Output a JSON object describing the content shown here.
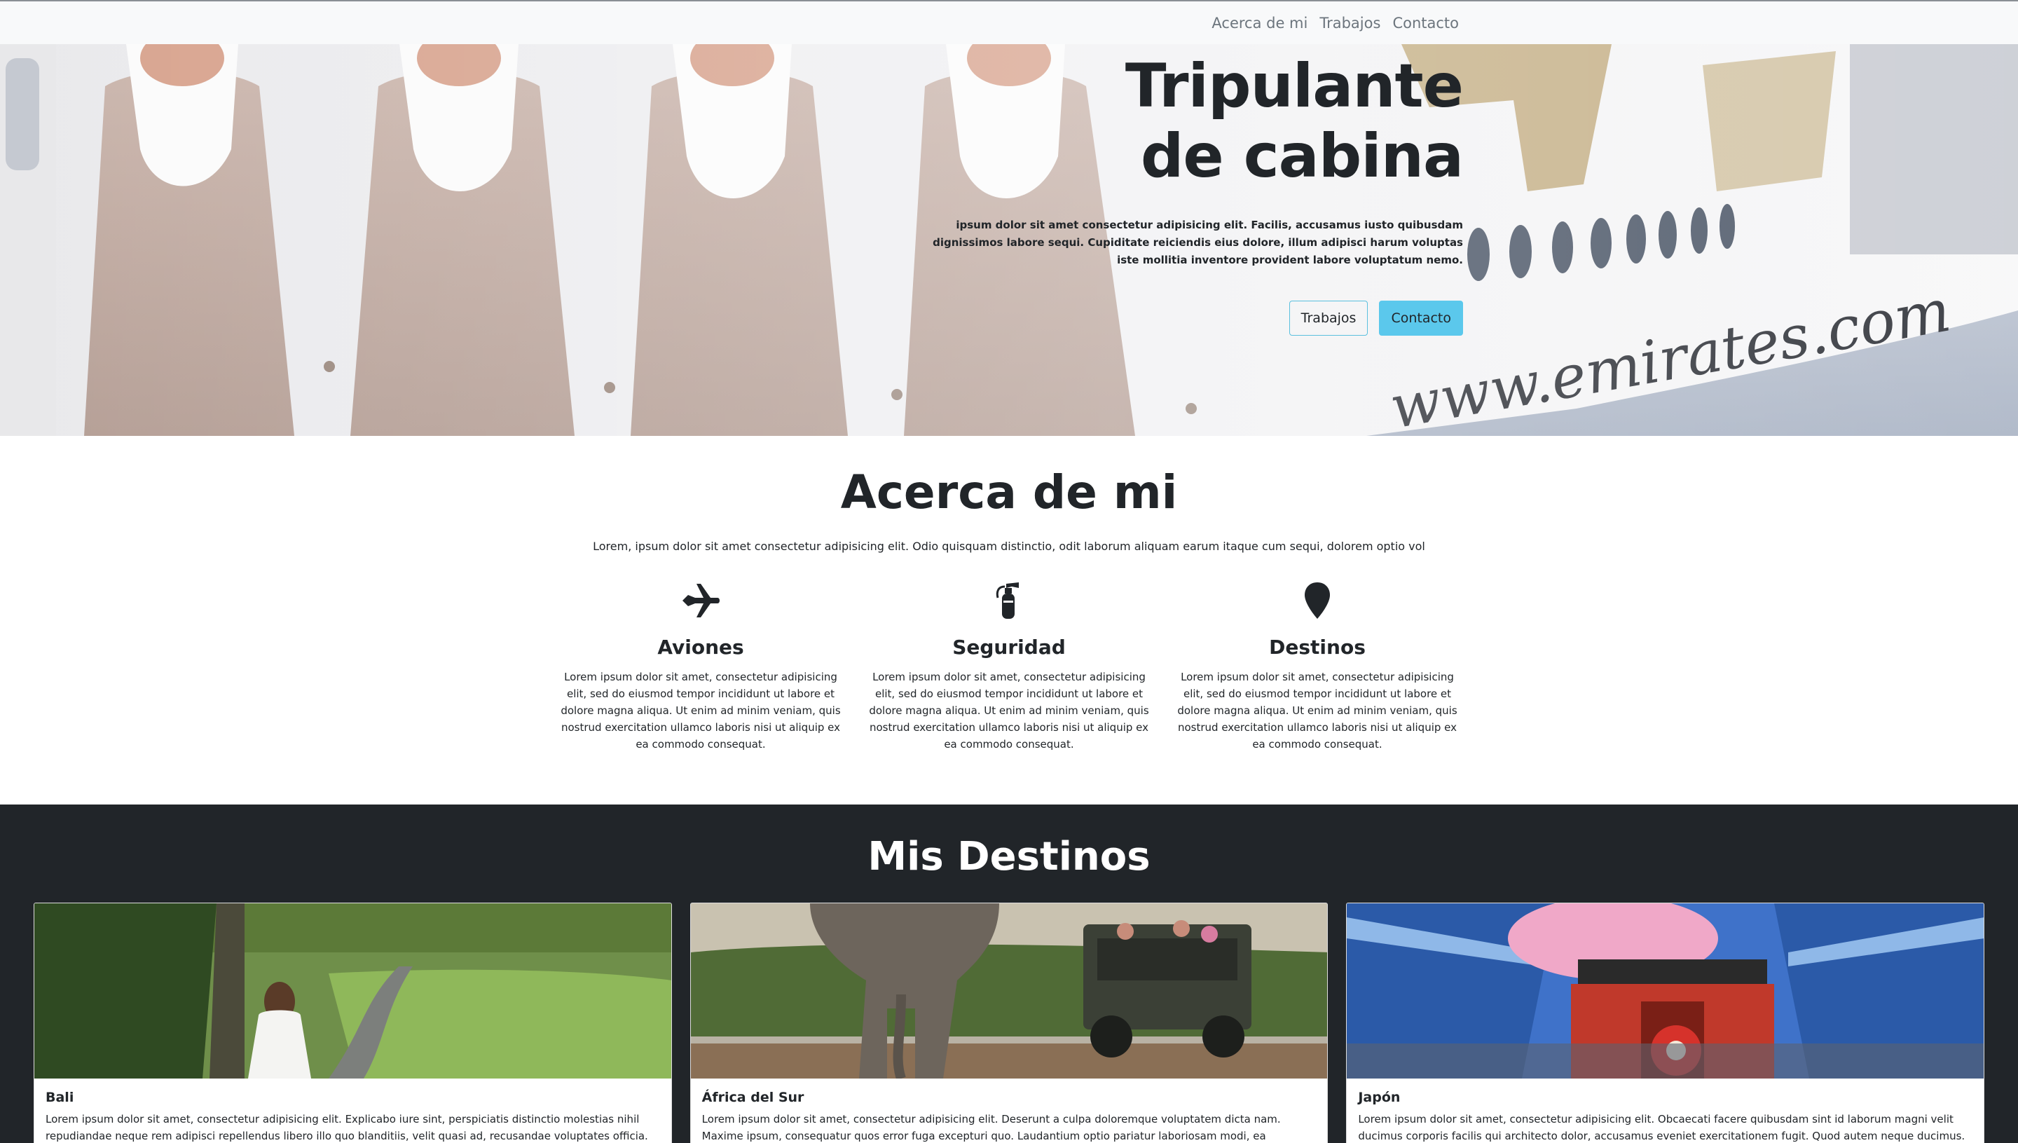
{
  "nav": {
    "links": [
      "Acerca de mi",
      "Trabajos",
      "Contacto"
    ]
  },
  "hero": {
    "title_line1": "Tripulante",
    "title_line2": "de cabina",
    "text": "ipsum dolor sit amet consectetur adipisicing elit. Facilis, accusamus iusto quibusdam dignissimos labore sequi. Cupiditate reiciendis eius dolore, illum adipisci harum voluptas iste mollitia inventore provident labore voluptatum nemo.",
    "buttons": {
      "primary": "Trabajos",
      "secondary": "Contacto"
    }
  },
  "about": {
    "title": "Acerca de mi",
    "lead": "Lorem, ipsum dolor sit amet consectetur adipisicing elit. Odio quisquam distinctio, odit laborum aliquam earum itaque cum sequi, dolorem optio vol",
    "features": [
      {
        "icon": "plane-icon",
        "title": "Aviones",
        "text": "Lorem ipsum dolor sit amet, consectetur adipisicing elit, sed do eiusmod tempor incididunt ut labore et dolore magna aliqua. Ut enim ad minim veniam, quis nostrud exercitation ullamco laboris nisi ut aliquip ex ea commodo consequat."
      },
      {
        "icon": "fire-extinguisher-icon",
        "title": "Seguridad",
        "text": "Lorem ipsum dolor sit amet, consectetur adipisicing elit, sed do eiusmod tempor incididunt ut labore et dolore magna aliqua. Ut enim ad minim veniam, quis nostrud exercitation ullamco laboris nisi ut aliquip ex ea commodo consequat."
      },
      {
        "icon": "map-marker-icon",
        "title": "Destinos",
        "text": "Lorem ipsum dolor sit amet, consectetur adipisicing elit, sed do eiusmod tempor incididunt ut labore et dolore magna aliqua. Ut enim ad minim veniam, quis nostrud exercitation ullamco laboris nisi ut aliquip ex ea commodo consequat."
      }
    ]
  },
  "destinations": {
    "title": "Mis Destinos",
    "cards": [
      {
        "title": "Bali",
        "text": "Lorem ipsum dolor sit amet, consectetur adipisicing elit. Explicabo iure sint, perspiciatis distinctio molestias nihil repudiandae neque rem adipisci repellendus libero illo quo blanditiis, velit quasi ad, recusandae voluptates officia."
      },
      {
        "title": "África del Sur",
        "text": "Lorem ipsum dolor sit amet, consectetur adipisicing elit. Deserunt a culpa doloremque voluptatem dicta nam. Maxime ipsum, consequatur quos error fuga excepturi quo. Laudantium optio pariatur laboriosam modi, ea molestias?"
      },
      {
        "title": "Japón",
        "text": "Lorem ipsum dolor sit amet, consectetur adipisicing elit. Obcaecati facere quibusdam sint id laborum magni velit ducimus corporis facilis qui architecto dolor, accusamus eveniet exercitationem fugit. Quod autem neque ducimus."
      }
    ]
  },
  "colors": {
    "accent": "#5bc8ec",
    "dark_section": "#212529",
    "navbar_bg": "#f8f9fa"
  }
}
